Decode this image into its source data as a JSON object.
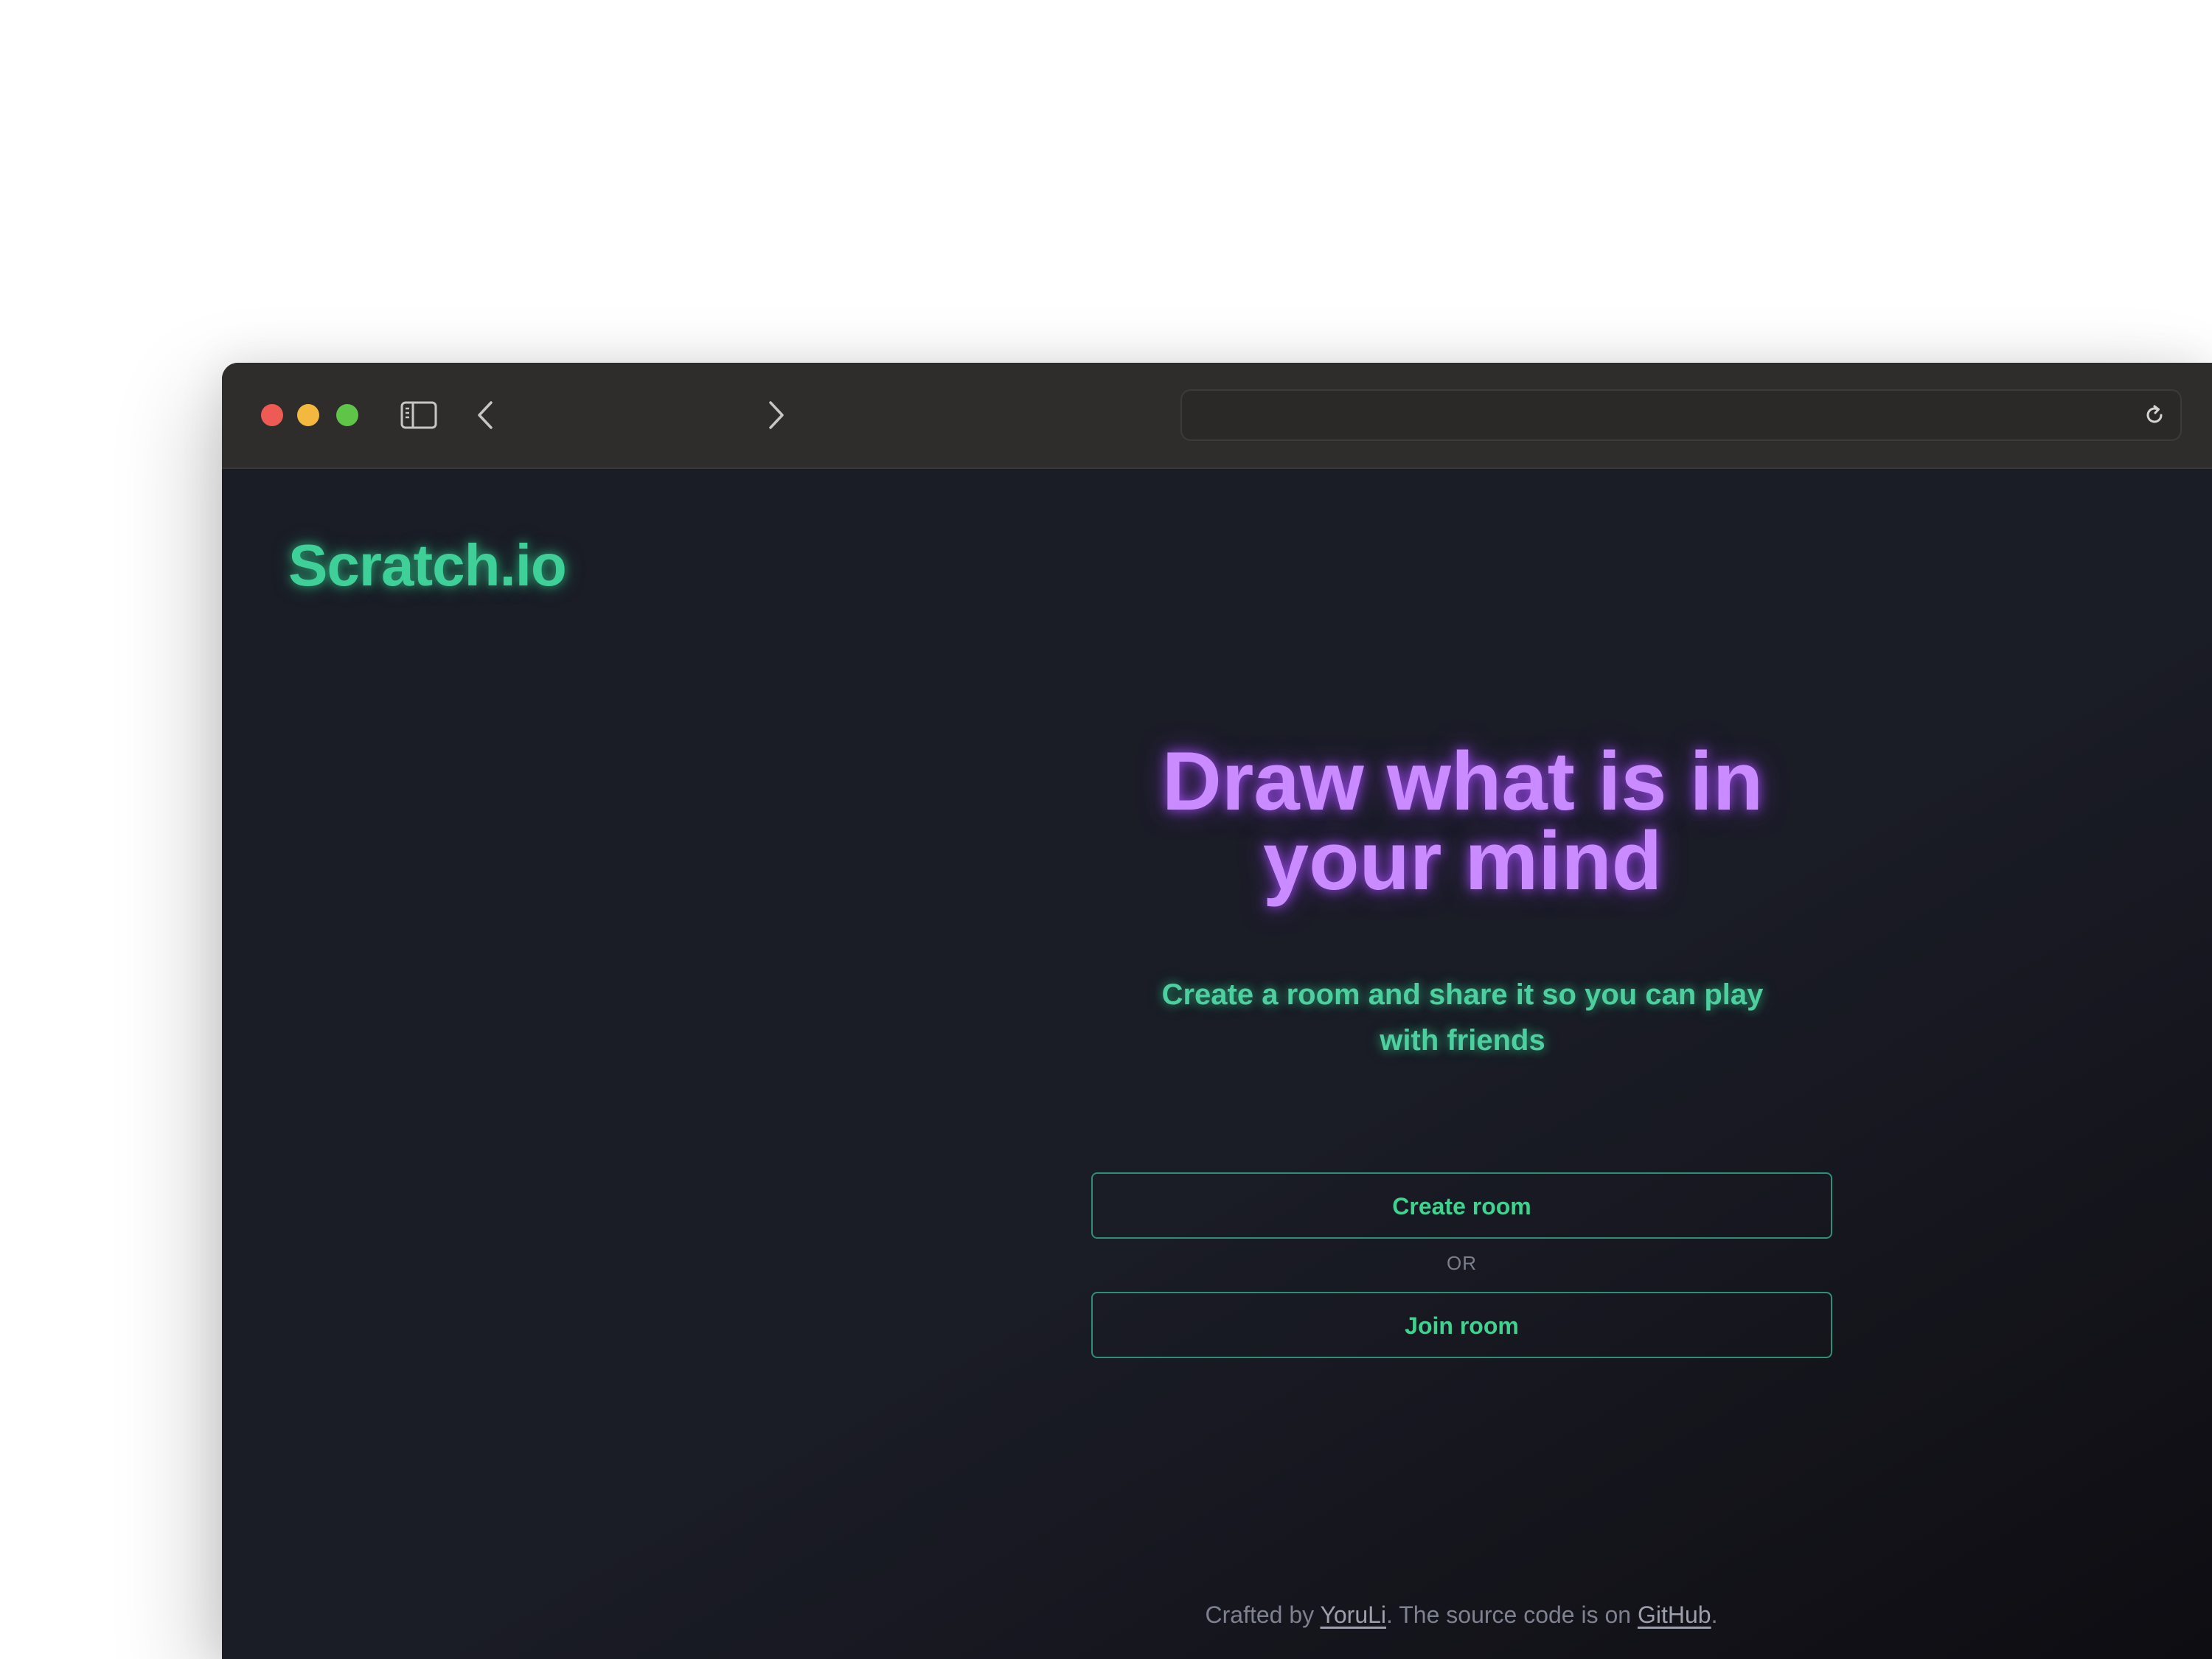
{
  "browser": {
    "url": "",
    "traffic_colors": {
      "close": "#ee5b54",
      "minimize": "#f3b93f",
      "maximize": "#5fc548"
    }
  },
  "app": {
    "logo": "Scratch.io",
    "headline_line1": "Draw what is in",
    "headline_line2": "your mind",
    "subtitle_line1": "Create a room and share it so you can play",
    "subtitle_line2": "with friends",
    "create_room_label": "Create room",
    "or_label": "OR",
    "join_room_label": "Join room"
  },
  "footer": {
    "prefix": "Crafted by ",
    "author": "YoruLi",
    "middle": ". The source code is on ",
    "repo": "GitHub",
    "suffix": "."
  },
  "colors": {
    "accent_green": "#3fcf98",
    "accent_purple": "#c98bff",
    "background": "#1a1c26"
  }
}
